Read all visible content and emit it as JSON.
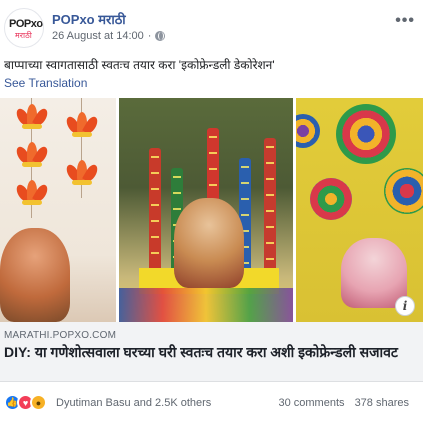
{
  "page": {
    "name": "POPxo मराठी",
    "avatar_text_main": "POPxo",
    "avatar_text_sub": "मराठी",
    "timestamp": "26 August at 14:00",
    "privacy_icon": "globe-icon",
    "more_icon": "more-options-icon"
  },
  "post": {
    "text": "बाप्पाच्या स्वागतासाठी स्वतःच तयार करा 'इकोफ्रेन्डली डेकोरेशन'",
    "see_translation": "See Translation"
  },
  "images": {
    "count": 3,
    "info_icon": "i"
  },
  "link_preview": {
    "domain": "MARATHI.POPXO.COM",
    "title": "DIY: या गणेशोत्सवाला घरच्या घरी स्वतःच तयार करा अशी इकोफ्रेन्डली सजावट"
  },
  "footer": {
    "reaction_icons": [
      "like-icon",
      "love-icon",
      "wow-icon"
    ],
    "reaction_summary": "Dyutiman Basu and 2.5K others",
    "comments": "30 comments",
    "shares": "378 shares"
  },
  "colors": {
    "link_blue": "#385898",
    "like": "#1877f2",
    "love": "#f33e58",
    "wow": "#f7b125",
    "link_box_bg": "#f2f3f5"
  }
}
